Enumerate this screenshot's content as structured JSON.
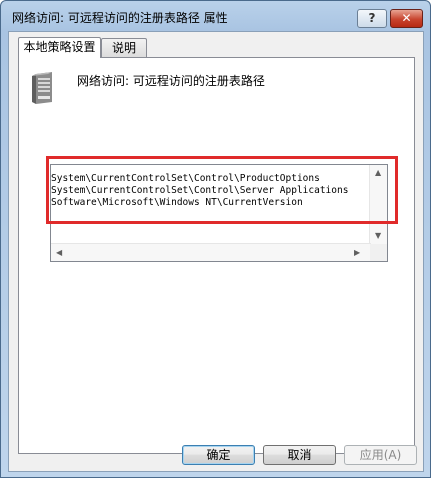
{
  "window": {
    "title": "网络访问: 可远程访问的注册表路径 属性",
    "help_label": "?",
    "close_label": "✕"
  },
  "tabs": [
    {
      "label": "本地策略设置",
      "active": true
    },
    {
      "label": "说明",
      "active": false
    }
  ],
  "policy": {
    "icon": "server-icon",
    "name": "网络访问: 可远程访问的注册表路径"
  },
  "registry_paths": [
    "System\\CurrentControlSet\\Control\\ProductOptions",
    "System\\CurrentControlSet\\Control\\Server Applications",
    "Software\\Microsoft\\Windows NT\\CurrentVersion"
  ],
  "buttons": {
    "ok": "确定",
    "cancel": "取消",
    "apply": "应用(A)"
  },
  "colors": {
    "highlight": "#e02a2a",
    "close_button": "#c8442e"
  }
}
